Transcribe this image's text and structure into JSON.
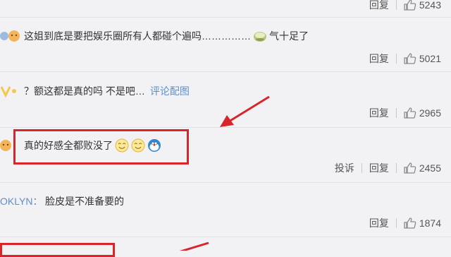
{
  "comments": [
    {
      "user": "",
      "text": "",
      "reply": "回复",
      "likes": "5243"
    },
    {
      "user": "",
      "text": "这姐到底是要把娱乐圈所有人都碰个遍吗……………",
      "text_tail": "气十足了",
      "reply": "回复",
      "likes": "5021"
    },
    {
      "user": "V",
      "text": "？额这都是真的吗 不是吧…",
      "link": "评论配图",
      "reply": "回复",
      "likes": "2965"
    },
    {
      "user": "",
      "text": "真的好感全都败没了",
      "report": "投诉",
      "reply": "回复",
      "likes": "2455"
    },
    {
      "user": "OKLYN：",
      "text": "脸皮是不准备要的",
      "reply": "回复",
      "likes": "1874"
    }
  ],
  "colors": {
    "accent": "#d8252c",
    "link": "#5a8fcf",
    "username": "#eb7350"
  },
  "icons": {
    "like": "thumbs-up-icon",
    "smile": "smile-emoji",
    "doraemon": "doraemon-emoji",
    "chestnut": "bowl-emoji"
  }
}
